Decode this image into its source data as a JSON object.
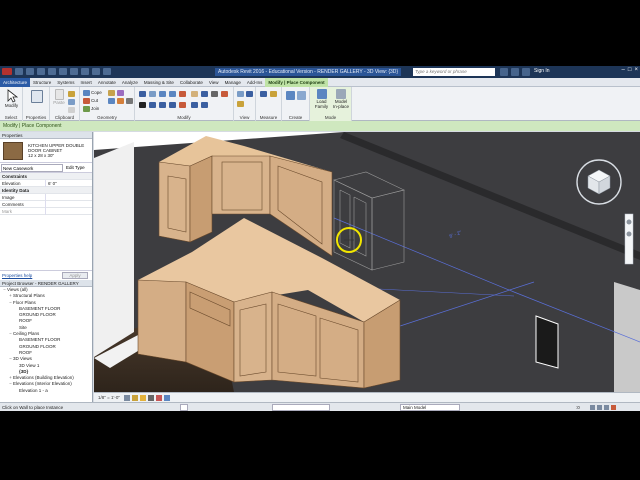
{
  "title_bar": {
    "title": "Autodesk Revit 2016 - Educational Version - RENDER GALLERY - 3D View: {3D}",
    "search_placeholder": "Type a keyword or phrase",
    "sign_in": "Sign In"
  },
  "ribbon_tabs": [
    "Architecture",
    "Structure",
    "Systems",
    "Insert",
    "Annotate",
    "Analyze",
    "Massing & Site",
    "Collaborate",
    "View",
    "Manage",
    "Add-Ins",
    "Modify | Place Component"
  ],
  "ribbon": {
    "modify_label": "Modify",
    "select_label": "Select",
    "properties_label": "Properties",
    "paste_label": "Paste",
    "cope_label": "Cope",
    "cut_label": "Cut",
    "join_label": "Join",
    "clipboard_label": "Clipboard",
    "geometry_label": "Geometry",
    "modify_panel_label": "Modify",
    "view_label": "View",
    "measure_label": "Measure",
    "create_label": "Create",
    "load_family_label": "Load Family",
    "model_inplace_label": "Model In-place",
    "mode_label": "Mode"
  },
  "context_bar": "Modify | Place Component",
  "properties": {
    "header": "Properties",
    "type_name": "KITCHEN UPPER DOUBLE DOOR CABINET",
    "type_size": "12 x 28 x 30\"",
    "instance_select": "New Casework",
    "edit_type": "Edit Type",
    "constraints_label": "Constraints",
    "elevation_label": "Elevation",
    "elevation_value": "6' 0\"",
    "identity_label": "Identity Data",
    "image_label": "Image",
    "comments_label": "Comments",
    "mark_label": "Mark",
    "help_link": "Properties help",
    "apply": "Apply"
  },
  "project_browser": {
    "header": "Project Browser - RENDER GALLERY",
    "nodes": [
      {
        "text": "Views (all)",
        "level": 0,
        "exp": "−"
      },
      {
        "text": "Structural Plans",
        "level": 1,
        "exp": "+"
      },
      {
        "text": "Floor Plans",
        "level": 1,
        "exp": "−"
      },
      {
        "text": "BASEMENT FLOOR",
        "level": 2,
        "exp": ""
      },
      {
        "text": "GROUND FLOOR",
        "level": 2,
        "exp": ""
      },
      {
        "text": "ROOF",
        "level": 2,
        "exp": ""
      },
      {
        "text": "Site",
        "level": 2,
        "exp": ""
      },
      {
        "text": "Ceiling Plans",
        "level": 1,
        "exp": "−"
      },
      {
        "text": "BASEMENT FLOOR",
        "level": 2,
        "exp": ""
      },
      {
        "text": "GROUND FLOOR",
        "level": 2,
        "exp": ""
      },
      {
        "text": "ROOF",
        "level": 2,
        "exp": ""
      },
      {
        "text": "3D Views",
        "level": 1,
        "exp": "−"
      },
      {
        "text": "3D View 1",
        "level": 2,
        "exp": ""
      },
      {
        "text": "{3D}",
        "level": 2,
        "exp": ""
      },
      {
        "text": "Elevations (Building Elevation)",
        "level": 1,
        "exp": "+"
      },
      {
        "text": "Elevations (Interior Elevation)",
        "level": 1,
        "exp": "−"
      },
      {
        "text": "Elevation 1 - a",
        "level": 2,
        "exp": ""
      }
    ]
  },
  "view_bar": {
    "scale": "1/8\" = 1'-0\""
  },
  "status_bar": {
    "message": "Click on Wall to place Instance",
    "model_field": "Main Model",
    "coord": ":0"
  },
  "dimension_text": "8' - 2\"",
  "colors": {
    "title_bg": "#1d3557",
    "context_tab": "#bfe3a6",
    "floor": "#3a3a3c",
    "cabinet_face": "#d8b38c",
    "highlight_circle": "#f2e600"
  }
}
